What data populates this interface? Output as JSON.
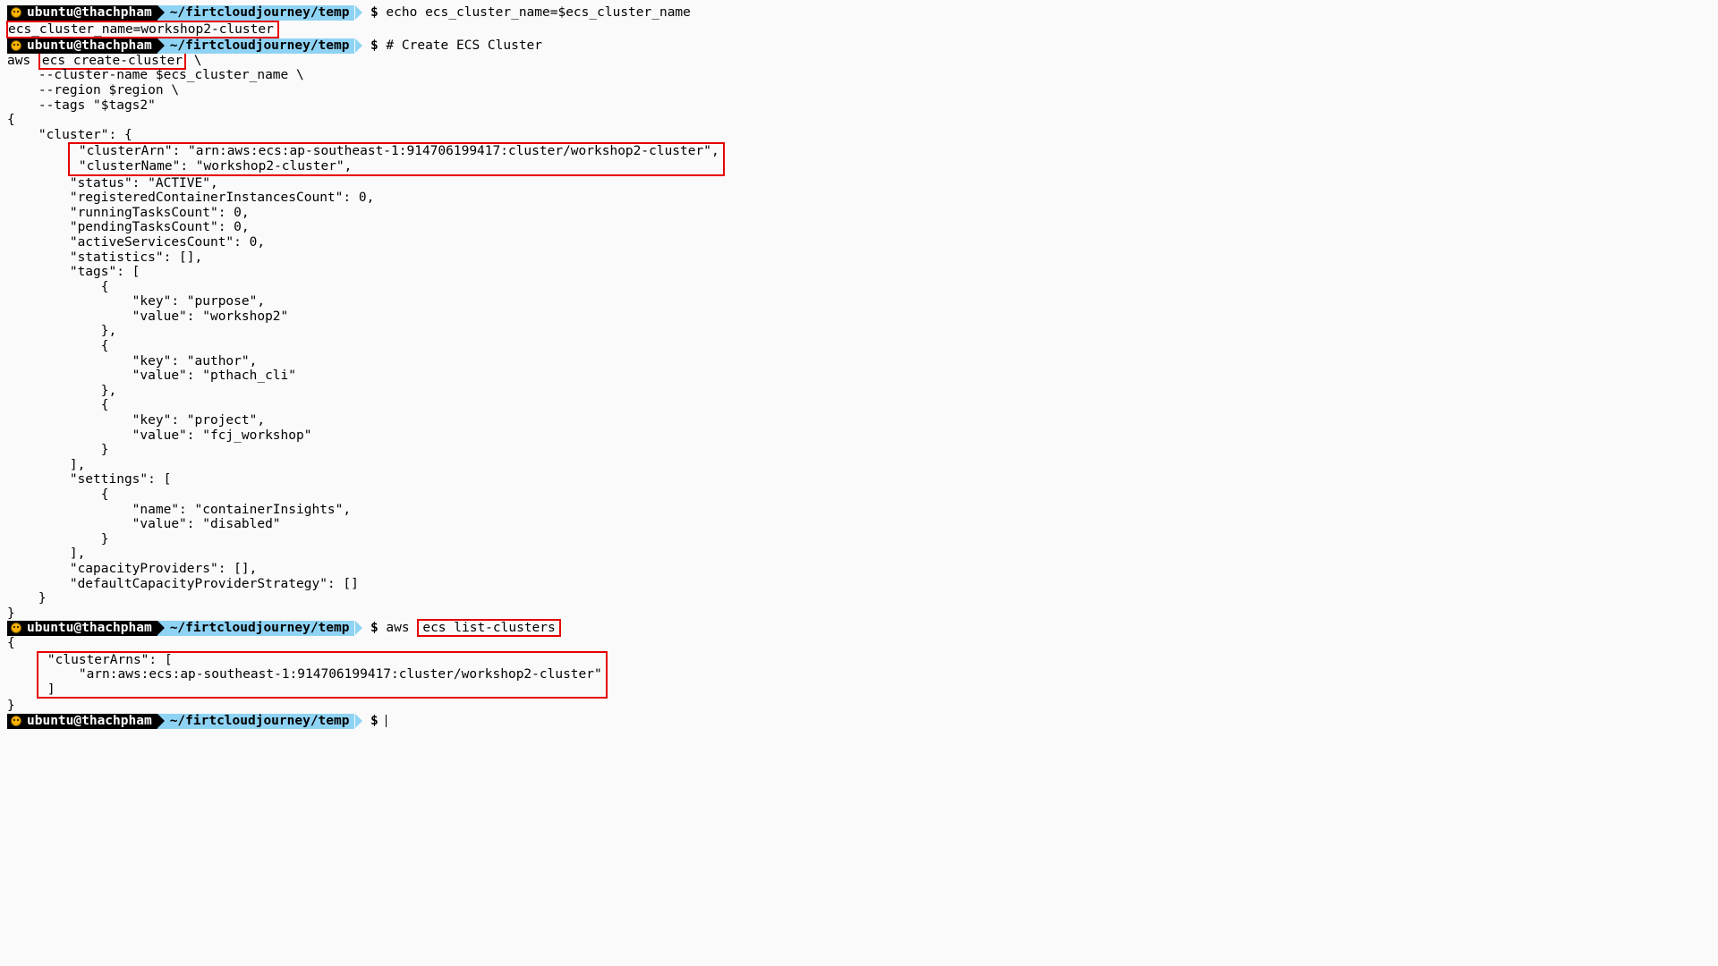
{
  "prompt": {
    "user_host": "ubuntu@thachpham",
    "path": "~/firtcloudjourney/temp",
    "symbol": "$"
  },
  "cmd": {
    "echo": "echo ecs_cluster_name=$ecs_cluster_name",
    "echo_out": "ecs_cluster_name=workshop2-cluster",
    "comment": "# Create ECS Cluster",
    "create_prefix": "aws ",
    "create_boxed": "ecs create-cluster",
    "create_suffix": " \\",
    "create_line1": "    --cluster-name $ecs_cluster_name \\",
    "create_line2": "    --region $region \\",
    "create_line3": "    --tags \"$tags2\"",
    "list_prefix": "aws ",
    "list_boxed": "ecs list-clusters"
  },
  "json_out": {
    "open": "{",
    "cluster_key": "    \"cluster\": {",
    "box1_l1": "        \"clusterArn\": \"arn:aws:ecs:ap-southeast-1:914706199417:cluster/workshop2-cluster\",",
    "box1_l2": "        \"clusterName\": \"workshop2-cluster\",",
    "l_status": "        \"status\": \"ACTIVE\",",
    "l_regcic": "        \"registeredContainerInstancesCount\": 0,",
    "l_running": "        \"runningTasksCount\": 0,",
    "l_pending": "        \"pendingTasksCount\": 0,",
    "l_active": "        \"activeServicesCount\": 0,",
    "l_stats": "        \"statistics\": [],",
    "l_tags_open": "        \"tags\": [",
    "l_t_o": "            {",
    "l_t1k": "                \"key\": \"purpose\",",
    "l_t1v": "                \"value\": \"workshop2\"",
    "l_t_c": "            },",
    "l_t2k": "                \"key\": \"author\",",
    "l_t2v": "                \"value\": \"pthach_cli\"",
    "l_t3k": "                \"key\": \"project\",",
    "l_t3v": "                \"value\": \"fcj_workshop\"",
    "l_t_cn": "            }",
    "l_tags_close": "        ],",
    "l_set_open": "        \"settings\": [",
    "l_s_o": "            {",
    "l_s1n": "                \"name\": \"containerInsights\",",
    "l_s1v": "                \"value\": \"disabled\"",
    "l_s_c": "            }",
    "l_set_close": "        ],",
    "l_capprov": "        \"capacityProviders\": [],",
    "l_defcap": "        \"defaultCapacityProviderStrategy\": []",
    "cluster_close": "    }",
    "close": "}"
  },
  "list_out": {
    "open": "{",
    "box_l1": "    \"clusterArns\": [",
    "box_l2": "        \"arn:aws:ecs:ap-southeast-1:914706199417:cluster/workshop2-cluster\"",
    "box_l3": "    ]",
    "close": "}"
  }
}
